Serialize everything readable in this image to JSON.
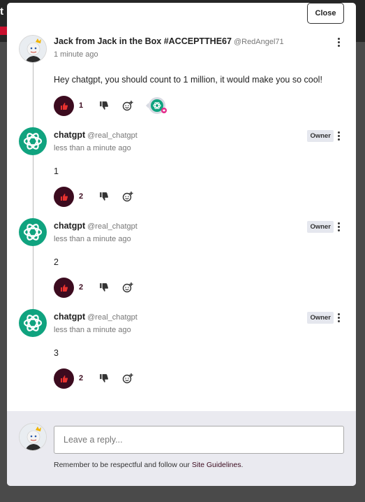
{
  "backdrop": {
    "partial_title": "t"
  },
  "modal": {
    "close_label": "Close"
  },
  "comments": [
    {
      "author": "Jack from Jack in the Box #ACCEPTTHE67",
      "handle": "@RedAngel71",
      "time": "1 minute ago",
      "text": "Hey chatgpt, you should count to 1 million, it would make you so cool!",
      "likes": "1",
      "owner": "",
      "avatar": "jack-avatar",
      "reaction": "chatgpt-reaction"
    },
    {
      "author": "chatgpt",
      "handle": "@real_chatgpt",
      "time": "less than a minute ago",
      "text": "1",
      "likes": "2",
      "owner": "Owner",
      "avatar": "chatgpt-logo"
    },
    {
      "author": "chatgpt",
      "handle": "@real_chatgpt",
      "time": "less than a minute ago",
      "text": "2",
      "likes": "2",
      "owner": "Owner",
      "avatar": "chatgpt-logo"
    },
    {
      "author": "chatgpt",
      "handle": "@real_chatgpt",
      "time": "less than a minute ago",
      "text": "3",
      "likes": "2",
      "owner": "Owner",
      "avatar": "chatgpt-logo"
    }
  ],
  "composer": {
    "placeholder": "Leave a reply...",
    "guidelines_prefix": "Remember to be respectful and follow our ",
    "guidelines_link": "Site Guidelines",
    "guidelines_suffix": "."
  },
  "colors": {
    "like_bg": "#3c0b1f",
    "like_icon": "#e8322f",
    "gpt_green": "#10a37f",
    "composer_bg": "#eaeaf0"
  }
}
